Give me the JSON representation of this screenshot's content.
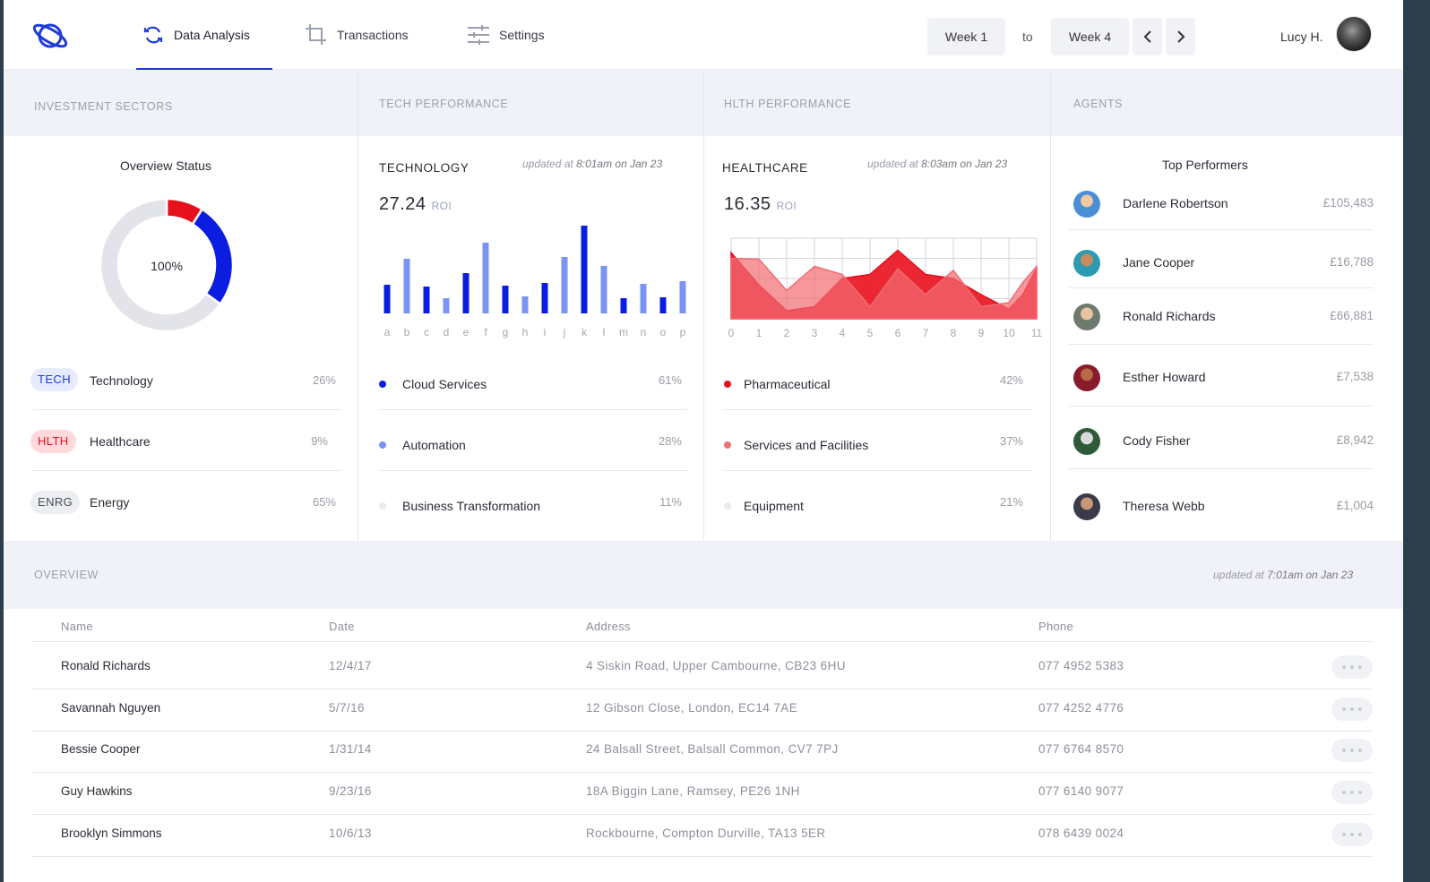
{
  "nav": {
    "tabs": [
      {
        "label": "Data Analysis",
        "icon": "sync-icon",
        "active": true
      },
      {
        "label": "Transactions",
        "icon": "crop-icon",
        "active": false
      },
      {
        "label": "Settings",
        "icon": "sliders-icon",
        "active": false
      }
    ],
    "week_from": "Week 1",
    "to_label": "to",
    "week_to": "Week 4",
    "user_name": "Lucy H."
  },
  "investment": {
    "header": "INVESTMENT SECTORS",
    "title": "Overview Status",
    "center_label": "100%",
    "sectors": [
      {
        "badge": "TECH",
        "name": "Technology",
        "pct": "26%",
        "color": "#0b1de0"
      },
      {
        "badge": "HLTH",
        "name": "Healthcare",
        "pct": "9%",
        "color": "#e8101c"
      },
      {
        "badge": "ENRG",
        "name": "Energy",
        "pct": "65%",
        "color": "#e3e4ea"
      }
    ]
  },
  "tech": {
    "header": "TECH PERFORMANCE",
    "title": "TECHNOLOGY",
    "updated_prefix": "updated at ",
    "updated_time": "8:01am on Jan 23",
    "roi_value": "27.24",
    "roi_label": "ROI",
    "items": [
      {
        "name": "Cloud Services",
        "pct": "61%",
        "color": "#0b1de0"
      },
      {
        "name": "Automation",
        "pct": "28%",
        "color": "#7b93f5"
      },
      {
        "name": "Business Transformation",
        "pct": "11%",
        "color": "#ebebef"
      }
    ]
  },
  "health": {
    "header": "HLTH PERFORMANCE",
    "title": "HEALTHCARE",
    "updated_prefix": "updated at ",
    "updated_time": "8:03am on Jan 23",
    "roi_value": "16.35",
    "roi_label": "ROI",
    "items": [
      {
        "name": "Pharmaceutical",
        "pct": "42%",
        "color": "#e8101c"
      },
      {
        "name": "Services and Facilities",
        "pct": "37%",
        "color": "#f07078"
      },
      {
        "name": "Equipment",
        "pct": "21%",
        "color": "#ebebef"
      }
    ]
  },
  "agents": {
    "header": "AGENTS",
    "title": "Top Performers",
    "list": [
      {
        "name": "Darlene Robertson",
        "value": "£105,483"
      },
      {
        "name": "Jane Cooper",
        "value": "£16,788"
      },
      {
        "name": "Ronald Richards",
        "value": "£66,881"
      },
      {
        "name": "Esther Howard",
        "value": "£7,538"
      },
      {
        "name": "Cody Fisher",
        "value": "£8,942"
      },
      {
        "name": "Theresa Webb",
        "value": "£1,004"
      }
    ]
  },
  "overview": {
    "header": "OVERVIEW",
    "updated_prefix": "updated at ",
    "updated_time": "7:01am on Jan 23",
    "columns": [
      "Name",
      "Date",
      "Address",
      "Phone"
    ],
    "rows": [
      [
        "Ronald Richards",
        "12/4/17",
        "4 Siskin Road, Upper Cambourne, CB23 6HU",
        "077 4952 5383"
      ],
      [
        "Savannah Nguyen",
        "5/7/16",
        "12 Gibson Close, London, EC14 7AE",
        "077 4252 4776"
      ],
      [
        "Bessie Cooper",
        "1/31/14",
        "24 Balsall Street, Balsall Common, CV7 7PJ",
        "077 6764 8570"
      ],
      [
        "Guy Hawkins",
        "9/23/16",
        "18A Biggin Lane, Ramsey, PE26 1NH",
        "077 6140 9077"
      ],
      [
        "Brooklyn Simmons",
        "10/6/13",
        "Rockbourne, Compton Durville, TA13 5ER",
        "078 6439 0024"
      ]
    ]
  },
  "chart_data": [
    {
      "type": "pie",
      "title": "Overview Status",
      "categories": [
        "Technology",
        "Healthcare",
        "Energy"
      ],
      "values": [
        26,
        9,
        65
      ],
      "colors": [
        "#0b1de0",
        "#e8101c",
        "#e3e4ea"
      ],
      "center_text": "100%"
    },
    {
      "type": "bar",
      "title": "TECHNOLOGY",
      "categories": [
        "a",
        "b",
        "c",
        "d",
        "e",
        "f",
        "g",
        "h",
        "i",
        "j",
        "k",
        "l",
        "m",
        "n",
        "o",
        "p"
      ],
      "series": [
        {
          "values": [
            32,
            61,
            30,
            17,
            45,
            79,
            31,
            19,
            34,
            63,
            98,
            53,
            17,
            33,
            18,
            36
          ]
        }
      ],
      "bar_colors": [
        "#0b1de0",
        "#7b93f5",
        "#0b1de0",
        "#7b93f5",
        "#0b1de0",
        "#7b93f5",
        "#0b1de0",
        "#7b93f5",
        "#0b1de0",
        "#7b93f5",
        "#0b1de0",
        "#7b93f5",
        "#0b1de0",
        "#7b93f5",
        "#0b1de0",
        "#7b93f5"
      ],
      "ylim": [
        0,
        100
      ],
      "grid": false
    },
    {
      "type": "area",
      "title": "HEALTHCARE",
      "x": [
        0,
        1,
        2,
        3,
        4,
        5,
        6,
        7,
        8,
        9,
        10,
        11
      ],
      "ylim": [
        0,
        100
      ],
      "series": [
        {
          "values": [
            82,
            42,
            10,
            15,
            50,
            55,
            85,
            55,
            50,
            30,
            12,
            30,
            63
          ]
        },
        {
          "values": [
            75,
            74,
            35,
            65,
            55,
            15,
            62,
            30,
            60,
            15,
            20,
            45,
            65
          ]
        }
      ],
      "series_x": [
        0,
        1,
        2,
        3,
        4,
        5,
        6,
        7,
        8,
        9,
        10,
        10.5,
        11
      ],
      "colors": [
        "#e8101c",
        "#f26b72"
      ],
      "grid": true
    }
  ]
}
